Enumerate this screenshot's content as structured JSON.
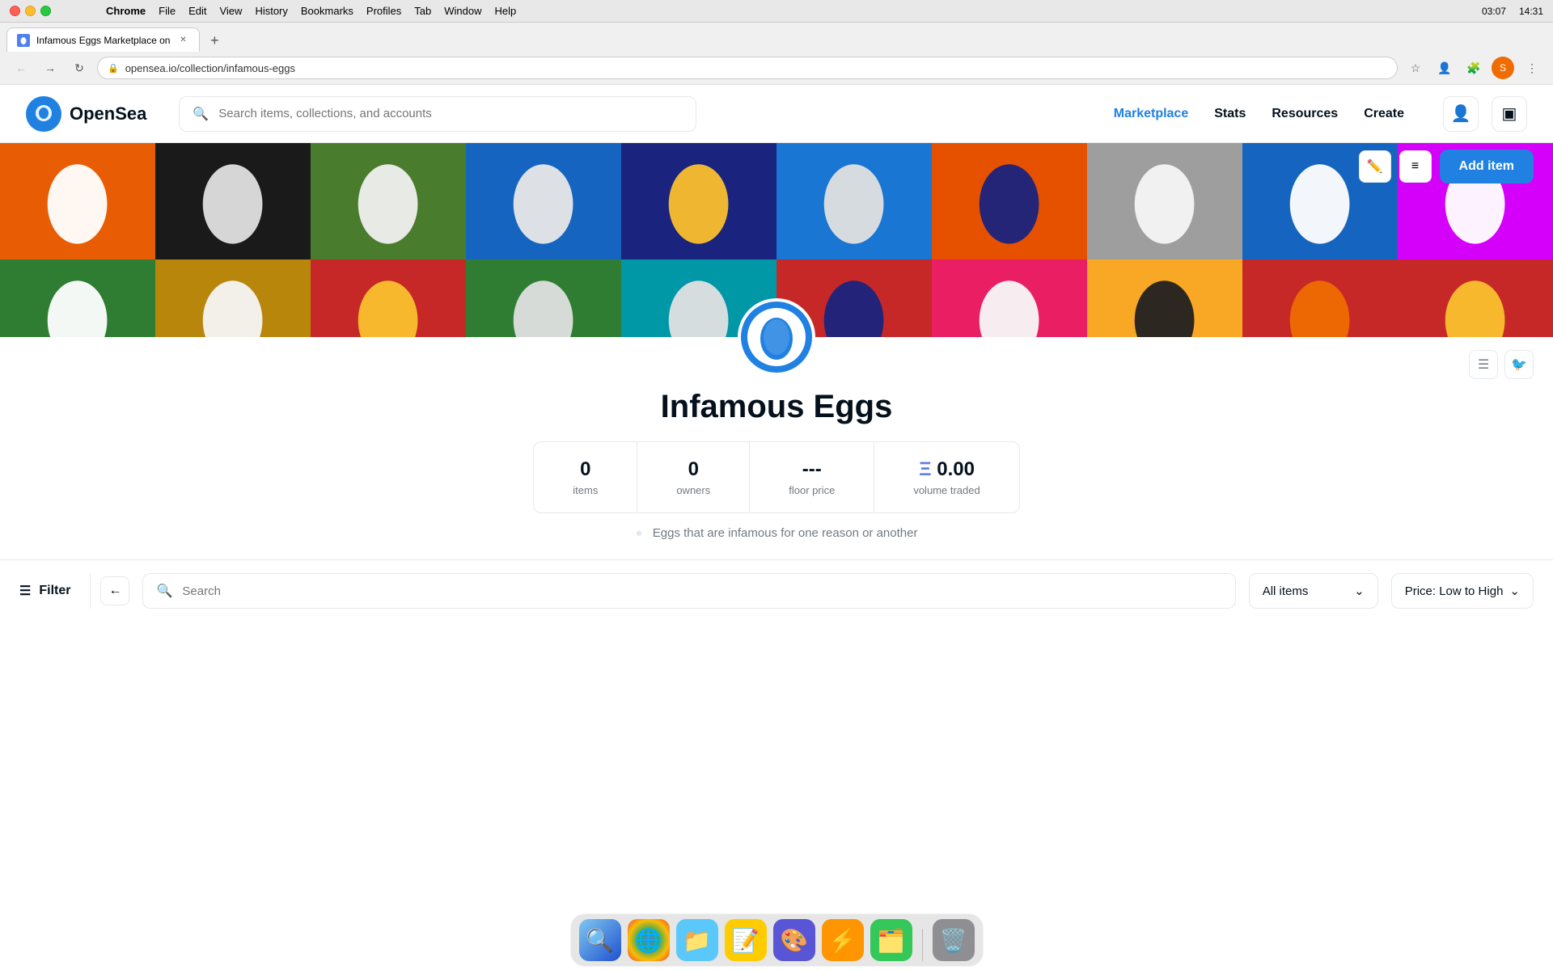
{
  "os": {
    "menu": [
      "Chrome",
      "File",
      "Edit",
      "View",
      "History",
      "Bookmarks",
      "Profiles",
      "Tab",
      "Window",
      "Help"
    ],
    "time": "14:31",
    "battery": "03:07"
  },
  "browser": {
    "tab_title": "Infamous Eggs Marketplace on",
    "tab_url": "opensea.io/collection/infamous-eggs",
    "new_tab_label": "+"
  },
  "header": {
    "logo_text": "OpenSea",
    "search_placeholder": "Search items, collections, and accounts",
    "nav": [
      "Marketplace",
      "Stats",
      "Resources",
      "Create"
    ],
    "add_item_label": "Add item"
  },
  "collection": {
    "title": "Infamous Eggs",
    "description": "Eggs that are infamous for one reason or another",
    "stats": {
      "items_value": "0",
      "items_label": "items",
      "owners_value": "0",
      "owners_label": "owners",
      "floor_price_value": "---",
      "floor_price_label": "floor price",
      "volume_value": "0.00",
      "volume_label": "volume traded"
    }
  },
  "filter": {
    "label": "Filter",
    "search_placeholder": "Search",
    "all_items_label": "All items",
    "price_sort_label": "Price: Low to High"
  },
  "banner": {
    "row1": [
      {
        "bg": "#e85d04",
        "egg": "#fff"
      },
      {
        "bg": "#1a1a1a",
        "egg": "#e0e0e0"
      },
      {
        "bg": "#4a7c2e",
        "egg": "#f0f0f0"
      },
      {
        "bg": "#1565c0",
        "egg": "#e8e8e8"
      },
      {
        "bg": "#1a237e",
        "egg": "#fbc02d"
      },
      {
        "bg": "#1976d2",
        "egg": "#e0e0e0"
      },
      {
        "bg": "#e65100",
        "egg": "#1a237e"
      },
      {
        "bg": "#9e9e9e",
        "egg": "#f5f5f5"
      },
      {
        "bg": "#1565c0",
        "egg": "#fff"
      },
      {
        "bg": "#d500f9",
        "egg": "#fff"
      }
    ],
    "row2": [
      {
        "bg": "#2e7d32",
        "egg": "#fff"
      },
      {
        "bg": "#b8860b",
        "egg": "#f5f5f5"
      },
      {
        "bg": "#c62828",
        "egg": "#fbc02d"
      },
      {
        "bg": "#2e7d32",
        "egg": "#e0e0e0"
      },
      {
        "bg": "#0097a7",
        "egg": "#e0e0e0"
      },
      {
        "bg": "#c62828",
        "egg": "#1a237e"
      },
      {
        "bg": "#e91e63",
        "egg": "#f8f8f8"
      },
      {
        "bg": "#f9a825",
        "egg": "#212121"
      },
      {
        "bg": "#c62828",
        "egg": "#ef6c00"
      },
      {
        "bg": "#c62828",
        "egg": "#fbc02d"
      }
    ]
  },
  "dock": {
    "items": [
      "🔍",
      "🌐",
      "📁",
      "📝",
      "🎨",
      "⚡",
      "🗂️",
      "🗑️"
    ]
  }
}
